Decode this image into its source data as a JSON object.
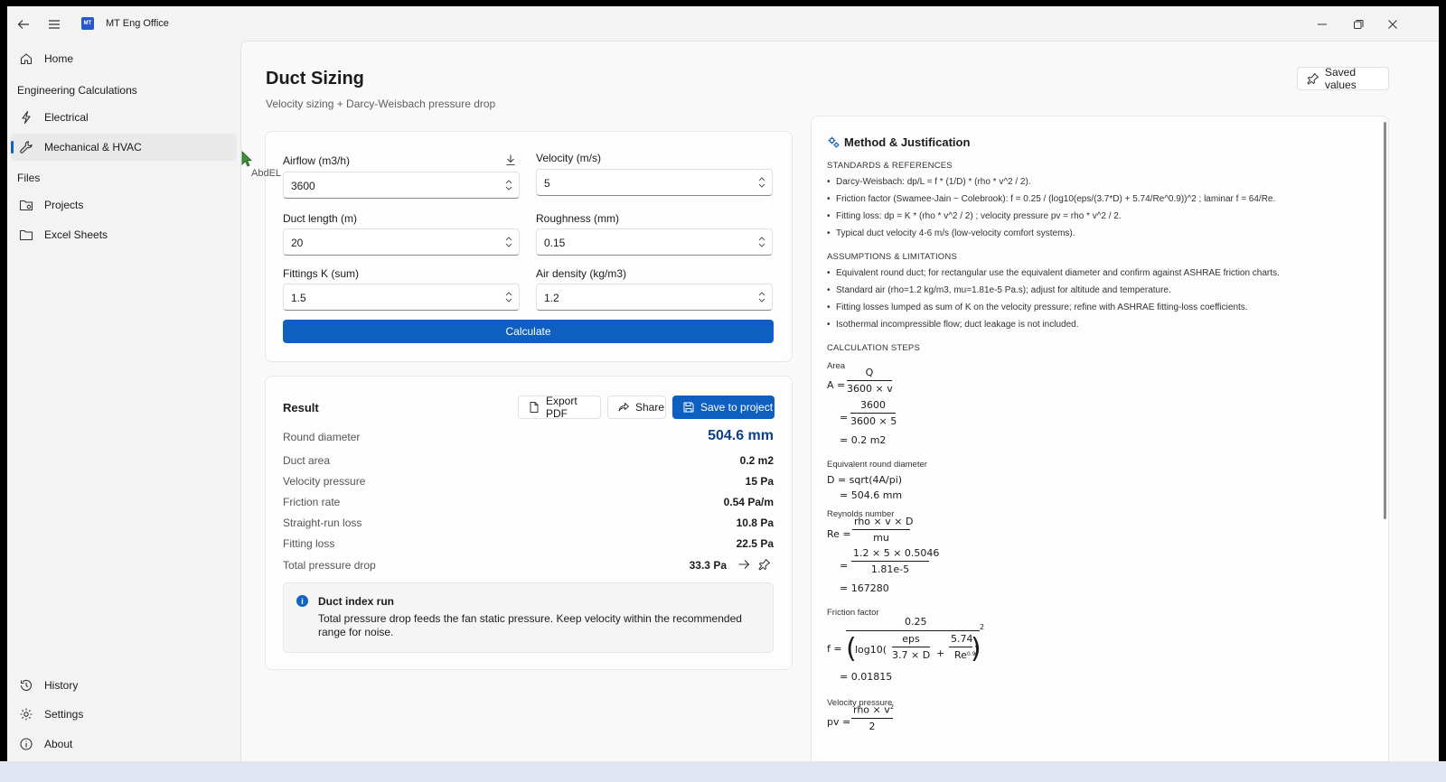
{
  "app": {
    "title": "MT Eng Office",
    "logo_text": "MT"
  },
  "sidebar": {
    "home": "Home",
    "header_calc": "Engineering Calculations",
    "electrical": "Electrical",
    "mechanical": "Mechanical & HVAC",
    "header_files": "Files",
    "projects": "Projects",
    "excel": "Excel Sheets",
    "history": "History",
    "settings": "Settings",
    "about": "About"
  },
  "cursor_label": "AbdEL",
  "page": {
    "title": "Duct Sizing",
    "subtitle": "Velocity sizing + Darcy-Weisbach pressure drop",
    "saved_values": "Saved values"
  },
  "inputs": {
    "airflow": {
      "label": "Airflow (m3/h)",
      "value": "3600"
    },
    "velocity": {
      "label": "Velocity (m/s)",
      "value": "5"
    },
    "length": {
      "label": "Duct length (m)",
      "value": "20"
    },
    "roughness": {
      "label": "Roughness (mm)",
      "value": "0.15"
    },
    "fittings": {
      "label": "Fittings K (sum)",
      "value": "1.5"
    },
    "density": {
      "label": "Air density (kg/m3)",
      "value": "1.2"
    },
    "calculate": "Calculate"
  },
  "result": {
    "title": "Result",
    "export_pdf": "Export PDF",
    "share": "Share",
    "save_project": "Save to project",
    "rows": [
      {
        "k": "Round diameter",
        "v": "504.6 mm"
      },
      {
        "k": "Duct area",
        "v": "0.2 m2"
      },
      {
        "k": "Velocity pressure",
        "v": "15 Pa"
      },
      {
        "k": "Friction rate",
        "v": "0.54 Pa/m"
      },
      {
        "k": "Straight-run loss",
        "v": "10.8 Pa"
      },
      {
        "k": "Fitting loss",
        "v": "22.5 Pa"
      },
      {
        "k": "Total pressure drop",
        "v": "33.3 Pa"
      }
    ],
    "info_title": "Duct index run",
    "info_text": "Total pressure drop feeds the fan static pressure. Keep velocity within the recommended range for noise."
  },
  "method": {
    "title": "Method & Justification",
    "sec_standards": "STANDARDS & REFERENCES",
    "standards": [
      "Darcy-Weisbach:  dp/L = f * (1/D) * (rho * v^2 / 2).",
      "Friction factor (Swamee-Jain ~ Colebrook):  f = 0.25 / (log10(eps/(3.7*D) + 5.74/Re^0.9))^2 ;  laminar f = 64/Re.",
      "Fitting loss:  dp = K * (rho * v^2 / 2) ;  velocity pressure pv = rho * v^2 / 2.",
      "Typical duct velocity 4-6 m/s (low-velocity comfort systems)."
    ],
    "sec_assumptions": "ASSUMPTIONS & LIMITATIONS",
    "assumptions": [
      "Equivalent round duct; for rectangular use the equivalent diameter and confirm against ASHRAE friction charts.",
      "Standard air (rho=1.2 kg/m3, mu=1.81e-5 Pa.s); adjust for altitude and temperature.",
      "Fitting losses lumped as sum of K on the velocity pressure; refine with ASHRAE fitting-loss coefficients.",
      "Isothermal incompressible flow; duct leakage is not included."
    ],
    "sec_steps": "CALCULATION STEPS",
    "area": {
      "label": "Area",
      "lhs": "A =",
      "n1": "Q",
      "d1": "3600 × v",
      "n2": "3600",
      "d2": "3600 × 5",
      "res": "= 0.2 m2"
    },
    "diam": {
      "label": "Equivalent round diameter",
      "eq": "D = sqrt(4A/pi)",
      "res": "= 504.6 mm"
    },
    "reynolds": {
      "label": "Reynolds number",
      "lhs": "Re =",
      "n1": "rho × v × D",
      "d1": "mu",
      "n2": "1.2 × 5 × 0.5046",
      "d2": "1.81e-5",
      "res": "= 167280"
    },
    "friction": {
      "label": "Friction factor",
      "lhs": "f =",
      "num": "0.25",
      "log": "log10(",
      "eps_n": "eps",
      "eps_d": "3.7 × D",
      "plus": "+",
      "re_n": "5.74",
      "re_d": "Re",
      "re_exp": "0.9",
      "close": ")",
      "sq": "2",
      "res": "= 0.01815"
    },
    "vp": {
      "label": "Velocity pressure",
      "lhs": "pv =",
      "n": "rho × v",
      "sq": "2",
      "d": "2"
    }
  }
}
